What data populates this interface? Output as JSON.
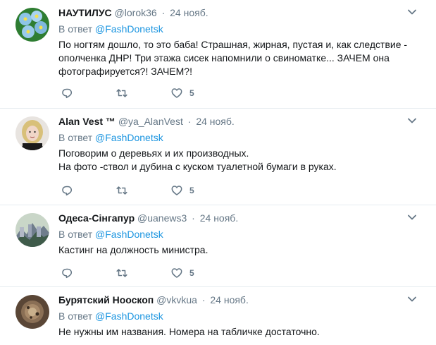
{
  "tweets": [
    {
      "name": "НАУТИЛУС",
      "handle": "@lorok36",
      "separator": "·",
      "date": "24 нояб.",
      "reply_prefix": "В ответ",
      "reply_to": "@FashDonetsk",
      "lines": [
        "По ногтям дошло, то это баба! Страшная, жирная, пустая и, как следствие -",
        "ополченка ДНР! Три этажа сисек напомнили о свиноматке... ЗАЧЕМ она",
        "фотографируется?! ЗАЧЕМ?!"
      ],
      "likes": "5"
    },
    {
      "name": "Alan Vest ™",
      "handle": "@ya_AlanVest",
      "separator": "·",
      "date": "24 нояб.",
      "reply_prefix": "В ответ",
      "reply_to": "@FashDonetsk",
      "lines": [
        "Поговорим о деревьях и их производных.",
        "На фото -ствол и дубина с куском туалетной бумаги в руках."
      ],
      "likes": "5"
    },
    {
      "name": "Одеса-Сінгапур",
      "handle": "@uanews3",
      "separator": "·",
      "date": "24 нояб.",
      "reply_prefix": "В ответ",
      "reply_to": "@FashDonetsk",
      "lines": [
        "Кастинг на должность министра."
      ],
      "likes": "5"
    },
    {
      "name": "Бурятский Нооскоп",
      "handle": "@vkvkua",
      "separator": "·",
      "date": "24 нояб.",
      "reply_prefix": "В ответ",
      "reply_to": "@FashDonetsk",
      "lines": [
        "Не нужны им названия. Номера на табличке достаточно."
      ]
    }
  ],
  "colors": {
    "link": "#1b95e0",
    "secondary": "#657786",
    "text": "#14171a",
    "divider": "#e6ecf0"
  },
  "icons": {
    "reply": "reply-icon",
    "retweet": "retweet-icon",
    "like": "heart-icon",
    "menu": "chevron-down-icon"
  }
}
